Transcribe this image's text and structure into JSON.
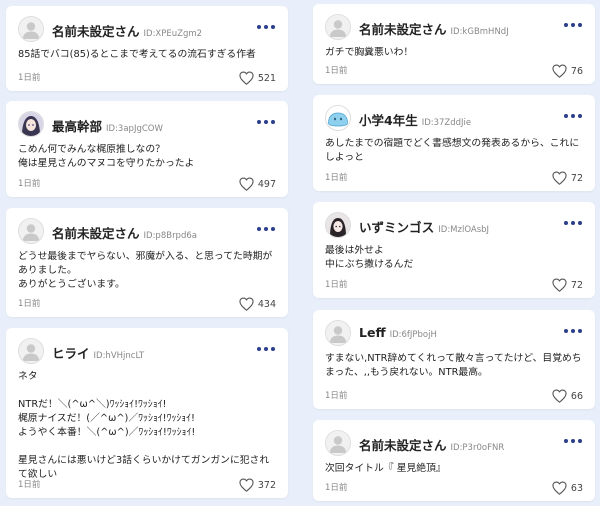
{
  "left_column": [
    {
      "username": "名前未設定さん",
      "user_id": "ID:XPEuZgm2",
      "avatar": "default-avatar",
      "text": "85話でバコ(85)るとこまで考えてるの流石すぎる作者",
      "time": "1日前",
      "likes": "521"
    },
    {
      "username": "最高幹部",
      "user_id": "ID:3apJgCOW",
      "avatar": "anime-girl-avatar",
      "text": "こめん何でみんな梶原推しなの？\n俺は星見さんのマヌコを守りたかったよ",
      "time": "1日前",
      "likes": "497"
    },
    {
      "username": "名前未設定さん",
      "user_id": "ID:p8Brpd6a",
      "avatar": "default-avatar",
      "text": "どうせ最後までヤらない、邪魔が入る、と思ってた時期がありました。\nありがとうございます。",
      "time": "1日前",
      "likes": "434"
    },
    {
      "username": "ヒライ",
      "user_id": "ID:hVHjncLT",
      "avatar": "default-avatar",
      "text": "ネタ\n\nNTRだ！＼(^ω^＼)ﾜｯｼｮｲ!ﾜｯｼｮｲ!\n梶原ナイスだ！(／^ω^)／ﾜｯｼｮｲ!ﾜｯｼｮｲ!\nようやく本番！＼(^ω^)／ﾜｯｼｮｲ!ﾜｯｼｮｲ!\n\n星見さんには悪いけど3話くらいかけてガンガンに犯されて欲しい",
      "time": "1日前",
      "likes": "372"
    }
  ],
  "right_column": [
    {
      "username": "名前未設定さん",
      "user_id": "ID:kGBmHNdJ",
      "avatar": "default-avatar",
      "text": "ガチで胸糞悪いわ！",
      "time": "1日前",
      "likes": "76"
    },
    {
      "username": "小学4年生",
      "user_id": "ID:37ZddJie",
      "avatar": "slime-avatar",
      "text": "あしたまでの宿題でどく書感想文の発表あるから、これにしよっと",
      "time": "1日前",
      "likes": "72"
    },
    {
      "username": "いずミンゴス",
      "user_id": "ID:MzlOAsbJ",
      "avatar": "dark-hair-avatar",
      "text": "最後は外せよ\n中にぶち撒けるんだ",
      "time": "1日前",
      "likes": "72"
    },
    {
      "username": "Leff",
      "user_id": "ID:6fJPbojH",
      "avatar": "default-avatar",
      "text": "すまない,NTR辞めてくれって散々言ってたけど、目覚めちまった、,,もう戻れない。NTR最高。",
      "time": "1日前",
      "likes": "66"
    },
    {
      "username": "名前未設定さん",
      "user_id": "ID:P3r0oFNR",
      "avatar": "default-avatar",
      "text": "次回タイトル『 星見絶頂』",
      "time": "1日前",
      "likes": "63"
    }
  ],
  "colors": {
    "page_background": "#e9effa",
    "more_dots": "#2b3f8c"
  }
}
